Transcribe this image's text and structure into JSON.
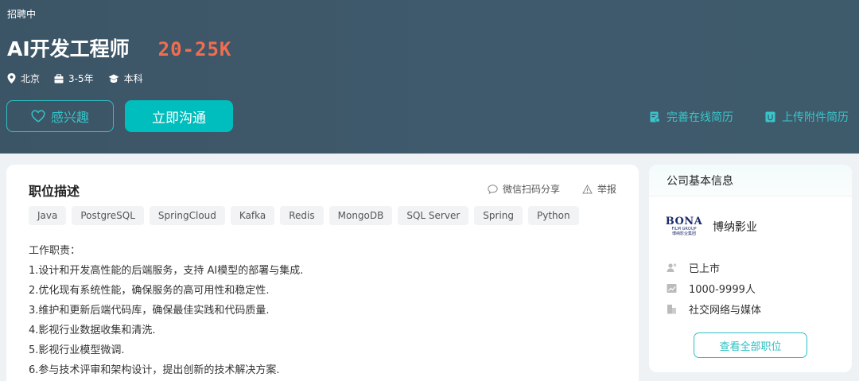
{
  "header": {
    "status": "招聘中",
    "job_title": "AI开发工程师",
    "salary": "20-25K",
    "meta": {
      "city": "北京",
      "experience": "3-5年",
      "degree": "本科"
    },
    "buttons": {
      "interest": "感兴趣",
      "chat": "立即沟通"
    },
    "links": {
      "improve_resume": "完善在线简历",
      "upload_resume": "上传附件简历"
    }
  },
  "job": {
    "section_title": "职位描述",
    "actions": {
      "share": "微信扫码分享",
      "report": "举报"
    },
    "tags": [
      "Java",
      "PostgreSQL",
      "SpringCloud",
      "Kafka",
      "Redis",
      "MongoDB",
      "SQL Server",
      "Spring",
      "Python"
    ],
    "description": [
      "工作职责：",
      "1.设计和开发高性能的后端服务，支持 AI模型的部署与集成.",
      "2.优化现有系统性能，确保服务的高可用性和稳定性.",
      "3.维护和更新后端代码库，确保最佳实践和代码质量.",
      "4.影视行业数据收集和清洗.",
      "5.影视行业模型微调.",
      "6.参与技术评审和架构设计，提出创新的技术解决方案."
    ]
  },
  "company": {
    "section_title": "公司基本信息",
    "logo_text": [
      "BONA",
      "FILM GROUP",
      "博纳影业集团"
    ],
    "name": "博纳影业",
    "info": {
      "financing": "已上市",
      "size": "1000-9999人",
      "industry": "社交网络与媒体"
    },
    "view_all": "查看全部职位"
  },
  "colors": {
    "banner": "#3f5a6c",
    "accent": "#00bebd",
    "salary": "#f26d4f"
  }
}
